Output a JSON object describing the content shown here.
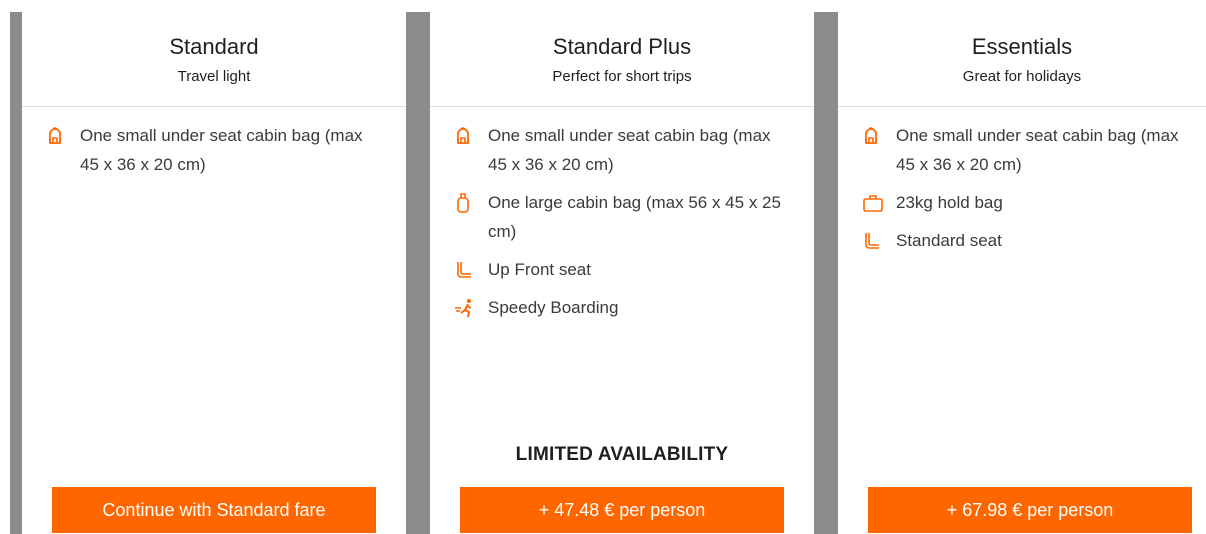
{
  "fares": [
    {
      "title": "Standard",
      "subtitle": "Travel light",
      "features": [
        {
          "icon": "backpack-icon",
          "text": "One small under seat cabin bag (max 45 x 36 x 20 cm)"
        }
      ],
      "availability": "",
      "button": "Continue with Standard fare"
    },
    {
      "title": "Standard Plus",
      "subtitle": "Perfect for short trips",
      "features": [
        {
          "icon": "backpack-icon",
          "text": "One small under seat cabin bag (max 45 x 36 x 20 cm)"
        },
        {
          "icon": "suitcase-icon",
          "text": "One large cabin bag (max 56 x 45 x 25 cm)"
        },
        {
          "icon": "seat-icon",
          "text": "Up Front seat"
        },
        {
          "icon": "running-person-icon",
          "text": "Speedy Boarding"
        }
      ],
      "availability": "LIMITED AVAILABILITY",
      "button": "+ 47.48 € per person"
    },
    {
      "title": "Essentials",
      "subtitle": "Great for holidays",
      "features": [
        {
          "icon": "backpack-icon",
          "text": "One small under seat cabin bag (max 45 x 36 x 20 cm)"
        },
        {
          "icon": "hold-bag-icon",
          "text": "23kg hold bag"
        },
        {
          "icon": "seat-icon",
          "text": "Standard seat"
        }
      ],
      "availability": "",
      "button": "+ 67.98 € per person"
    }
  ],
  "colors": {
    "accent": "#ff6600",
    "divider": "#8c8c8c"
  }
}
